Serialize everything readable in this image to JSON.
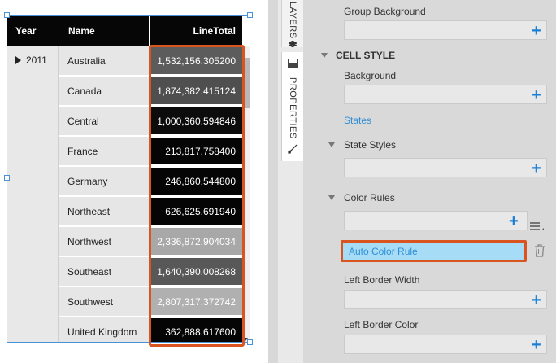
{
  "table": {
    "headers": {
      "year": "Year",
      "name": "Name",
      "total": "LineTotal"
    },
    "year_value": "2011",
    "rows": [
      {
        "name": "Australia",
        "value": "1,532,156.305200",
        "color": "#5c5c5c"
      },
      {
        "name": "Canada",
        "value": "1,874,382.415124",
        "color": "#4f4f4f"
      },
      {
        "name": "Central",
        "value": "1,000,360.594846",
        "color": "#0c0c0c"
      },
      {
        "name": "France",
        "value": "213,817.758400",
        "color": "#050505"
      },
      {
        "name": "Germany",
        "value": "246,860.544800",
        "color": "#050505"
      },
      {
        "name": "Northeast",
        "value": "626,625.691940",
        "color": "#050505"
      },
      {
        "name": "Northwest",
        "value": "2,336,872.904034",
        "color": "#a8a8a8"
      },
      {
        "name": "Southeast",
        "value": "1,640,390.008268",
        "color": "#585858"
      },
      {
        "name": "Southwest",
        "value": "2,807,317.372742",
        "color": "#b0b0b0"
      },
      {
        "name": "United Kingdom",
        "value": "362,888.617600",
        "color": "#050505"
      }
    ]
  },
  "tabs": {
    "layers": "LAYERS",
    "properties": "PROPERTIES"
  },
  "panel": {
    "group_background": "Group Background",
    "section_cell_style": "CELL STYLE",
    "background": "Background",
    "states_link": "States",
    "state_styles": "State Styles",
    "color_rules": "Color Rules",
    "auto_color_rule": "Auto Color Rule",
    "left_border_width": "Left Border Width",
    "left_border_color": "Left Border Color"
  },
  "colors": {
    "accent": "#1a7fd4",
    "highlight_outline": "#d9541e",
    "selected_rule_bg": "#a6dcf5"
  }
}
